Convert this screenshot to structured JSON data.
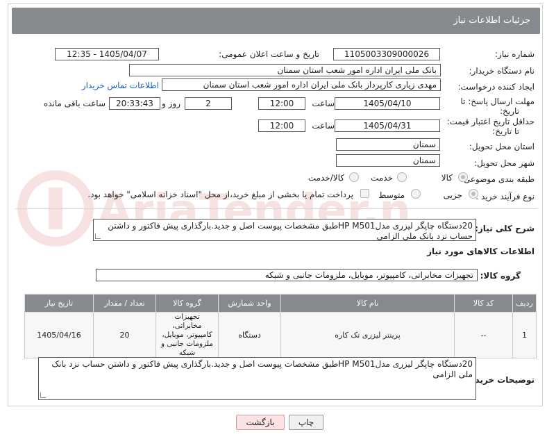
{
  "header": {
    "title": "جزئیات اطلاعات نیاز"
  },
  "fields": {
    "need_number_label": "شماره نیاز:",
    "need_number": "1105003309000026",
    "announce_label": "تاریخ و ساعت اعلان عمومی:",
    "announce_value": "1405/04/07 - 12:35",
    "buyer_org_label": "نام دستگاه خریدار:",
    "buyer_org": "بانک ملی ایران اداره امور شعب استان سمنان",
    "creator_label": "ایجاد کننده درخواست:",
    "creator": "مهدی زیاری کارپرداز بانک ملی ایران اداره امور شعب استان سمنان",
    "contact_link": "اطلاعات تماس خریدار",
    "deadline_label_1": "مهلت ارسال پاسخ: تا",
    "deadline_label_2": "تاریخ:",
    "deadline_date": "1405/04/10",
    "time_label": "ساعت",
    "deadline_time": "12:00",
    "days_value": "2",
    "days_label": "روز و",
    "remaining_time": "20:33:43",
    "remaining_label": "ساعت باقی مانده",
    "validity_label_1": "حداقل تاریخ اعتبار قیمت:",
    "validity_label_2": "تا تاریخ:",
    "validity_date": "1405/04/31",
    "validity_time": "12:00",
    "province_label": "استان محل تحویل:",
    "province": "سمنان",
    "city_label": "شهر محل تحویل:",
    "city": "سمنان",
    "category_label": "طبقه بندی موضوعی:",
    "category_options": [
      "کالا",
      "خدمت",
      "کالا/خدمت"
    ],
    "process_label": "نوع فرآیند خرید :",
    "process_options": [
      "جزیی",
      "متوسط"
    ],
    "payment_note": "پرداخت تمام یا بخشی از مبلغ خرید،از محل \"اسناد خزانه اسلامی\" خواهد بود.",
    "description_label": "شرح کلی نیاز:",
    "description": "20دستگاه چاپگر لیزری مدلHP M501طبق مشخصات پیوست اصل و جدید.بارگذاری پیش فاکتور و داشتن حساب نزد بانک ملی الزامی",
    "goods_info_label": "اطلاعات کالاهای مورد نیاز",
    "goods_group_label": "گروه کالا:",
    "goods_group": "تجهیزات مخابراتی، کامپیوتر، موبایل، ملزومات جانبی و شبکه",
    "buyer_notes_label": "توضیحات خریدار:",
    "buyer_notes": "20دستگاه چاپگر لیزری مدلHP M501طبق مشخصات پیوست اصل و جدید.بارگذاری پیش فاکتور و داشتن حساب نزد بانک ملی الزامی"
  },
  "table": {
    "headers": [
      "ردیف",
      "کد کالا",
      "نام کالا",
      "واحد شمارش",
      "گروه کالا",
      "تعداد / مقدار",
      "تاریخ نیاز"
    ],
    "rows": [
      [
        "1",
        "--",
        "پرینتر لیزری تک کاره",
        "دستگاه",
        "تجهیزات مخابراتی، کامپیوتر، موبایل، ملزومات جانبی و شبکه",
        "20",
        "1405/04/16"
      ]
    ]
  },
  "buttons": {
    "print": "چاپ",
    "back": "بازگشت"
  },
  "watermark": "AriaTender.net"
}
